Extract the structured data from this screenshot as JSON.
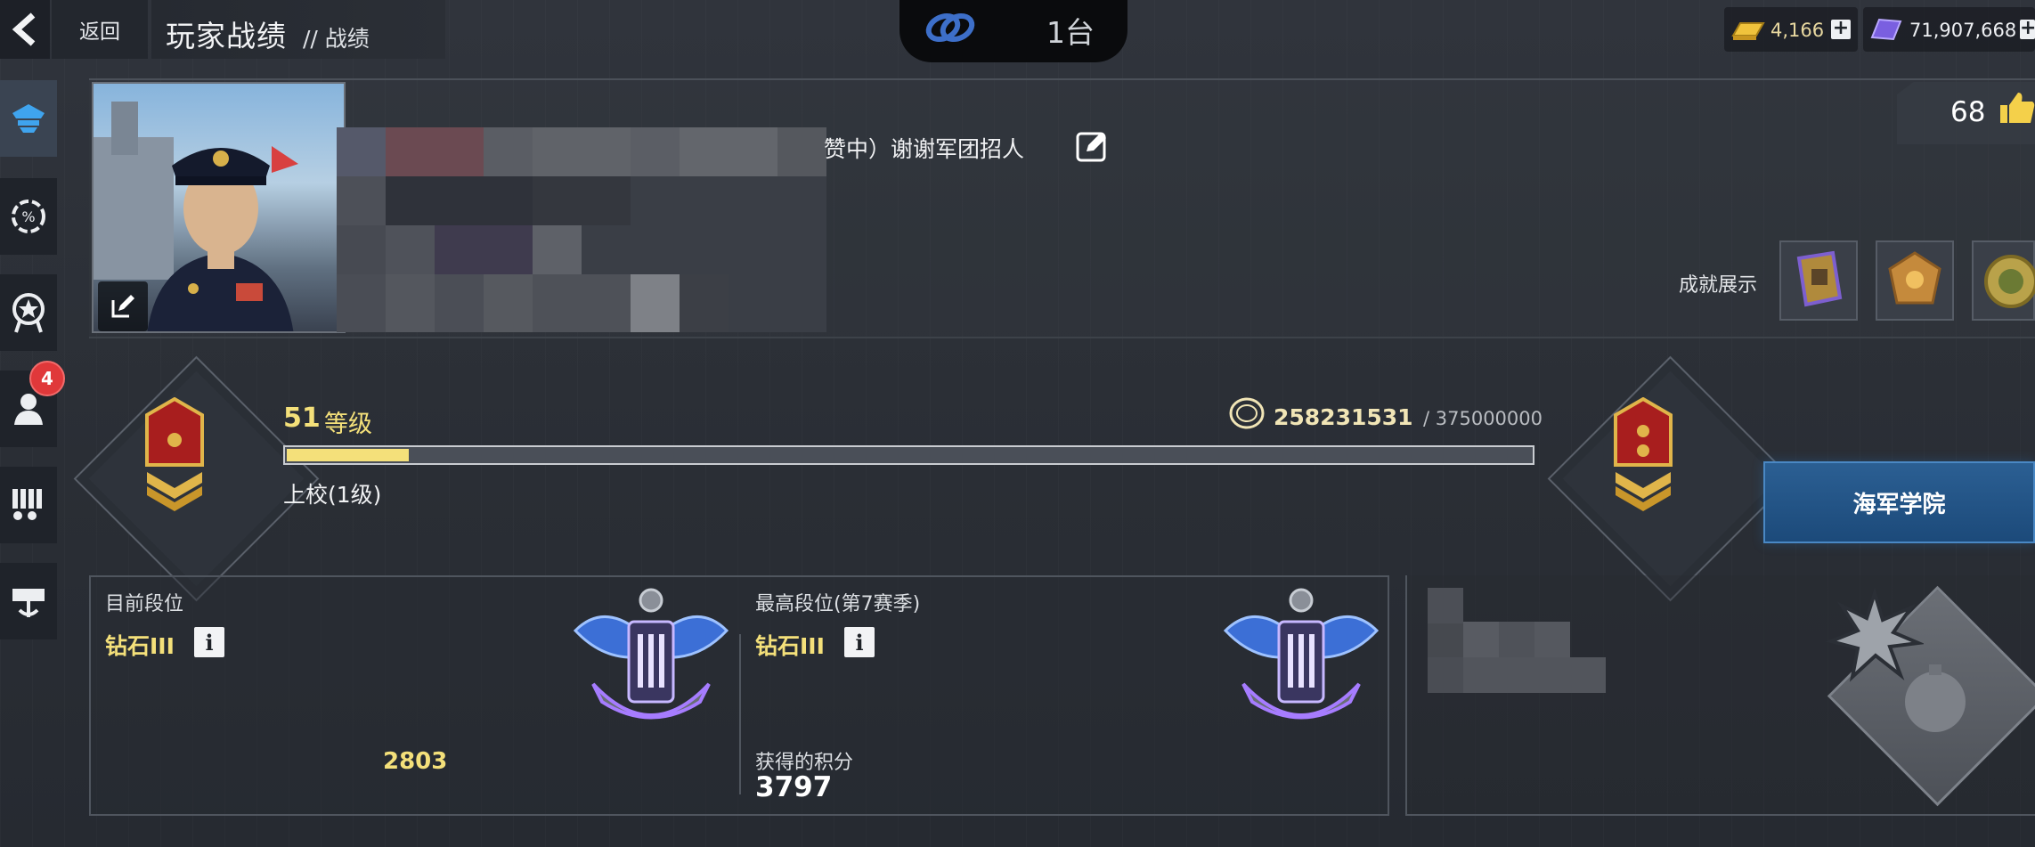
{
  "header": {
    "back_label": "返回",
    "title": "玩家战绩",
    "subtitle": "// 战绩",
    "status_text": "1台"
  },
  "resources": {
    "gold": "4,166",
    "gems": "71,907,668"
  },
  "sidebar": {
    "items": [
      {
        "name": "sidebar-item-profile",
        "icon": "officer-cap-icon",
        "active": true
      },
      {
        "name": "sidebar-item-stats",
        "icon": "percent-gear-icon",
        "active": false
      },
      {
        "name": "sidebar-item-medals",
        "icon": "medal-icon",
        "active": false
      },
      {
        "name": "sidebar-item-crew",
        "icon": "crew-icon",
        "active": false,
        "badge": "4"
      },
      {
        "name": "sidebar-item-ammo",
        "icon": "ammo-icon",
        "active": false
      },
      {
        "name": "sidebar-item-port",
        "icon": "harbor-icon",
        "active": false
      }
    ]
  },
  "profile": {
    "name_suffix": "赞中）谢谢军团招人",
    "likes": "68",
    "achievements_label": "成就展示"
  },
  "rank": {
    "level_num": "51",
    "level_unit": "等级",
    "xp_current": "258231531",
    "xp_max": "/ 375000000",
    "xp_progress": 0.098,
    "rank_name": "上校(1级)",
    "academy_button": "海军学院"
  },
  "segments": {
    "current": {
      "label": "目前段位",
      "rank": "钻石III",
      "score": "2803"
    },
    "best": {
      "label": "最高段位(第7赛季)",
      "rank": "钻石III",
      "points_label": "获得的积分",
      "points": "3797"
    }
  },
  "colors": {
    "accent_gold": "#f4e07a",
    "academy_blue": "#2b5f93",
    "badge_red": "#e0383a"
  }
}
